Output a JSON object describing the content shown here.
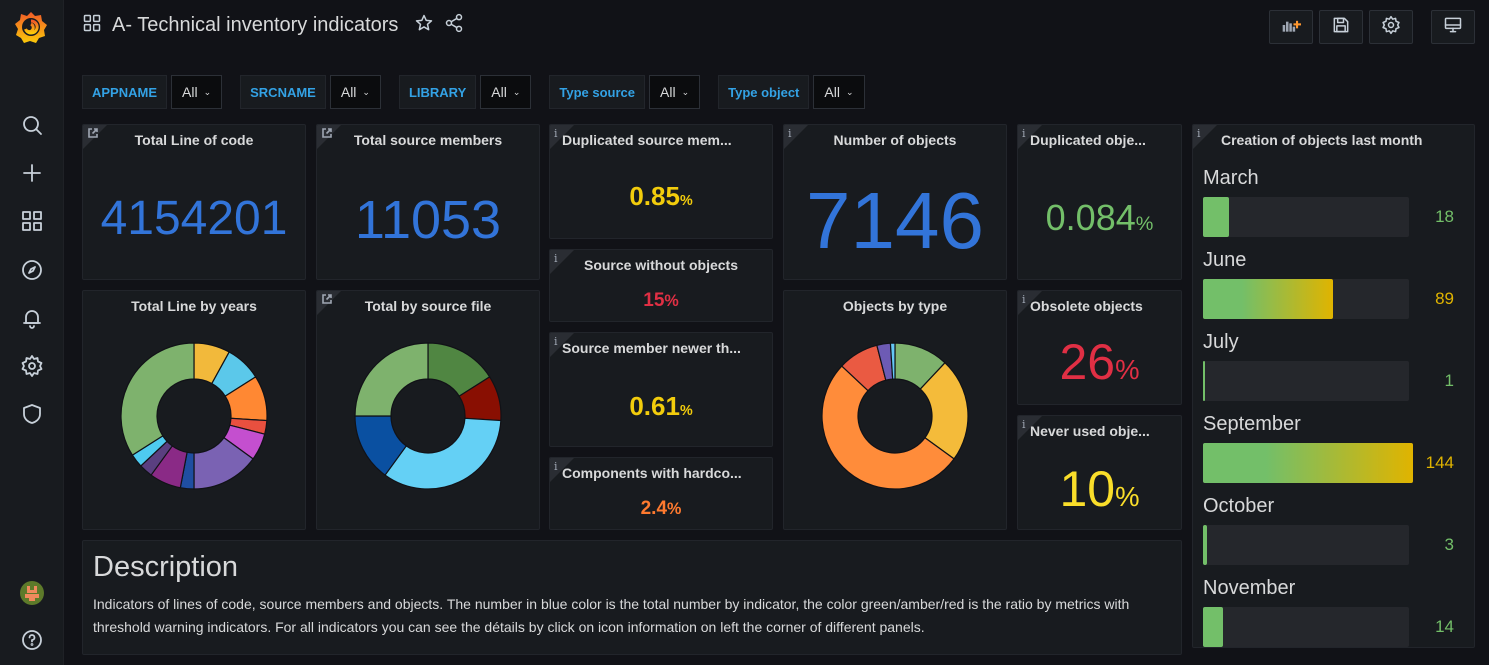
{
  "app": {
    "title": "A- Technical inventory indicators",
    "logo": "grafana-logo-icon"
  },
  "sidebar": {
    "items": [
      {
        "name": "search",
        "icon": "search-icon"
      },
      {
        "name": "create",
        "icon": "plus-icon"
      },
      {
        "name": "dashboards",
        "icon": "grid-icon"
      },
      {
        "name": "explore",
        "icon": "compass-icon"
      },
      {
        "name": "alerting",
        "icon": "bell-icon"
      },
      {
        "name": "configuration",
        "icon": "gear-icon"
      },
      {
        "name": "server-admin",
        "icon": "shield-icon"
      }
    ],
    "bottom": [
      {
        "name": "profile",
        "icon": "avatar"
      },
      {
        "name": "help",
        "icon": "question-icon"
      }
    ]
  },
  "toolbar": {
    "buttons": [
      {
        "name": "add-panel",
        "icon": "add-panel-icon"
      },
      {
        "name": "save-dashboard",
        "icon": "save-icon"
      },
      {
        "name": "dashboard-settings",
        "icon": "gear-icon"
      },
      {
        "name": "cycle-view-mode",
        "icon": "monitor-icon"
      }
    ]
  },
  "variables": [
    {
      "label": "APPNAME",
      "value": "All"
    },
    {
      "label": "SRCNAME",
      "value": "All"
    },
    {
      "label": "LIBRARY",
      "value": "All"
    },
    {
      "label": "Type source",
      "value": "All"
    },
    {
      "label": "Type object",
      "value": "All"
    }
  ],
  "panels": {
    "total_loc": {
      "title": "Total Line of code",
      "value": "4154201",
      "color": "#3274d9"
    },
    "total_src": {
      "title": "Total source members",
      "value": "11053",
      "color": "#3274d9"
    },
    "dup_src": {
      "title": "Duplicated source mem...",
      "value": "0.85",
      "unit": "%",
      "color": "#f2cc0c"
    },
    "src_no_obj": {
      "title": "Source without objects",
      "value": "15",
      "unit": "%",
      "color": "#e02f44"
    },
    "src_newer": {
      "title": "Source member newer th...",
      "value": "0.61",
      "unit": "%",
      "color": "#f2cc0c"
    },
    "hardcoded": {
      "title": "Components with hardco...",
      "value": "2.4",
      "unit": "%",
      "color": "#ff7a2f"
    },
    "num_obj": {
      "title": "Number of objects",
      "value": "7146",
      "color": "#3274d9"
    },
    "dup_obj": {
      "title": "Duplicated obje...",
      "value": "0.084",
      "unit": "%",
      "color": "#73bf69"
    },
    "obsolete": {
      "title": "Obsolete objects",
      "value": "26",
      "unit": "%",
      "color": "#e02f44"
    },
    "never_used": {
      "title": "Never used obje...",
      "value": "10",
      "unit": "%",
      "color": "#fade2a"
    },
    "line_years": {
      "title": "Total Line by years"
    },
    "by_source": {
      "title": "Total by source file"
    },
    "by_type": {
      "title": "Objects by type"
    },
    "creation": {
      "title": "Creation of objects last month"
    },
    "description": {
      "title": "Description",
      "text": "Indicators of lines of code, source members and objects. The number in blue color is the total number by indicator, the color green/amber/red is the ratio by metrics with threshold warning indicators. For all indicators you can see the détails by click on icon information on left the corner of different panels."
    }
  },
  "chart_data": [
    {
      "type": "pie",
      "title": "Total Line by years",
      "donut": true,
      "values": [
        8,
        8,
        10,
        3,
        6,
        15,
        3,
        7,
        3,
        3,
        34
      ],
      "colors": [
        "#f2b93b",
        "#5bc8ea",
        "#ff8833",
        "#e9503f",
        "#c44fcf",
        "#7a62b3",
        "#1f4ea1",
        "#8a2a86",
        "#5a3f80",
        "#4ecbf0",
        "#7eb26d"
      ]
    },
    {
      "type": "pie",
      "title": "Total by source file",
      "donut": true,
      "values": [
        16,
        10,
        34,
        15,
        25
      ],
      "colors": [
        "#508642",
        "#890f02",
        "#64d0f5",
        "#0a50a1",
        "#7eb26d"
      ]
    },
    {
      "type": "pie",
      "title": "Objects by type",
      "donut": true,
      "values": [
        12,
        23,
        52,
        9,
        3,
        1
      ],
      "colors": [
        "#7eb26d",
        "#f4bb3a",
        "#ff8c3a",
        "#ea5a42",
        "#6d5bb4",
        "#64c7f5"
      ]
    },
    {
      "type": "bar",
      "title": "Creation of objects last month",
      "orientation": "horizontal",
      "categories": [
        "March",
        "June",
        "July",
        "September",
        "October",
        "November"
      ],
      "values": [
        18,
        89,
        1,
        144,
        3,
        14
      ],
      "value_colors": [
        "#73bf69",
        "#e0b400",
        "#73bf69",
        "#e0b400",
        "#73bf69",
        "#73bf69"
      ],
      "max": 144
    }
  ]
}
